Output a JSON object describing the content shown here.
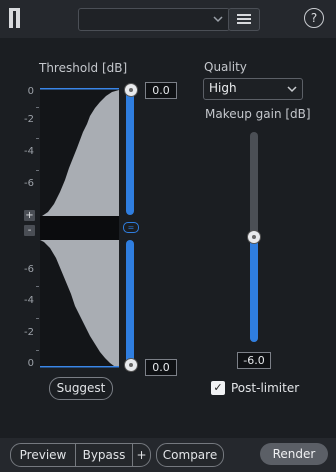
{
  "header": {
    "preset_value": "",
    "chevron_icon": "chevron-down",
    "menu_icon": "hamburger-menu",
    "help_label": "?"
  },
  "threshold": {
    "label": "Threshold [dB]",
    "upper_ticks": [
      "0",
      "-2",
      "-4",
      "-6"
    ],
    "lower_ticks": [
      "-6",
      "-4",
      "-2",
      "0"
    ],
    "top_value": "0.0",
    "bottom_value": "0.0",
    "plus_label": "+",
    "minus_label": "-",
    "link_label": "=",
    "suggest_label": "Suggest"
  },
  "quality": {
    "label": "Quality",
    "value": "High",
    "chevron_icon": "chevron-down"
  },
  "makeup": {
    "label": "Makeup gain [dB]",
    "value": "-6.0",
    "level": 0.5
  },
  "post_limiter": {
    "label": "Post-limiter",
    "checked": true,
    "check_glyph": "✓"
  },
  "footer": {
    "preview_label": "Preview",
    "bypass_label": "Bypass",
    "plus_label": "+",
    "compare_label": "Compare",
    "render_label": "Render"
  },
  "colors": {
    "accent": "#2f7ee0",
    "background": "#1b1e22",
    "panel": "#25282d"
  }
}
